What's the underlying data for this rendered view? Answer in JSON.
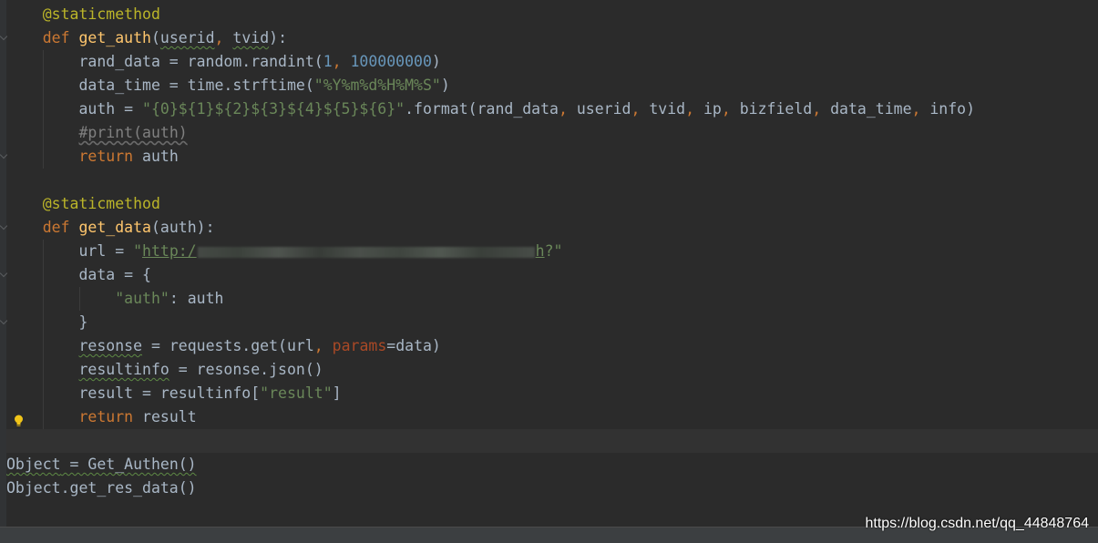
{
  "editor": {
    "lines": [
      [
        {
          "t": "    "
        },
        {
          "t": "@staticmethod",
          "c": "deco"
        }
      ],
      [
        {
          "t": "    "
        },
        {
          "t": "def ",
          "c": "kw"
        },
        {
          "t": "get_auth",
          "c": "fn"
        },
        {
          "t": "("
        },
        {
          "t": "userid",
          "w": 1
        },
        {
          "t": ", ",
          "c": "kw"
        },
        {
          "t": "tvid",
          "w": 1
        },
        {
          "t": "):"
        }
      ],
      [
        {
          "t": "        rand_data = random.randint("
        },
        {
          "t": "1",
          "c": "num"
        },
        {
          "t": ", ",
          "c": "kw"
        },
        {
          "t": "100000000",
          "c": "num"
        },
        {
          "t": ")"
        }
      ],
      [
        {
          "t": "        data_time = time.strftime("
        },
        {
          "t": "\"%Y%m%d%H%M%S\"",
          "c": "str"
        },
        {
          "t": ")"
        }
      ],
      [
        {
          "t": "        auth = "
        },
        {
          "t": "\"{0}${1}${2}${3}${4}${5}${6}\"",
          "c": "str"
        },
        {
          "t": ".format(rand_data"
        },
        {
          "t": ", ",
          "c": "kw"
        },
        {
          "t": "userid"
        },
        {
          "t": ", ",
          "c": "kw"
        },
        {
          "t": "tvid"
        },
        {
          "t": ", ",
          "c": "kw"
        },
        {
          "t": "ip"
        },
        {
          "t": ", ",
          "c": "kw"
        },
        {
          "t": "bizfield"
        },
        {
          "t": ", ",
          "c": "kw"
        },
        {
          "t": "data_time"
        },
        {
          "t": ", ",
          "c": "kw"
        },
        {
          "t": "info)"
        }
      ],
      [
        {
          "t": "        "
        },
        {
          "t": "#print(auth)",
          "c": "cmt"
        }
      ],
      [
        {
          "t": "        "
        },
        {
          "t": "return ",
          "c": "kw"
        },
        {
          "t": "auth"
        }
      ],
      [],
      [
        {
          "t": "    "
        },
        {
          "t": "@staticmethod",
          "c": "deco"
        }
      ],
      [
        {
          "t": "    "
        },
        {
          "t": "def ",
          "c": "kw"
        },
        {
          "t": "get_data",
          "c": "fn"
        },
        {
          "t": "(auth):"
        }
      ],
      [
        {
          "t": "        url = "
        },
        {
          "t": "\"",
          "c": "str"
        },
        {
          "t": "http:/",
          "c": "str",
          "l": 1
        },
        {
          "blur": 1
        },
        {
          "t": "h",
          "c": "str",
          "l": 1
        },
        {
          "t": "?\"",
          "c": "str"
        }
      ],
      [
        {
          "t": "        data = {"
        }
      ],
      [
        {
          "t": "            "
        },
        {
          "t": "\"auth\"",
          "c": "str"
        },
        {
          "t": ": auth"
        }
      ],
      [
        {
          "t": "        }"
        }
      ],
      [
        {
          "t": "        "
        },
        {
          "t": "resonse",
          "w": 1
        },
        {
          "t": " = requests.get(url"
        },
        {
          "t": ", ",
          "c": "kw"
        },
        {
          "t": "params",
          "c": "param"
        },
        {
          "t": "=data)"
        }
      ],
      [
        {
          "t": "        "
        },
        {
          "t": "resultinfo",
          "w": 1
        },
        {
          "t": " = resonse.json()"
        }
      ],
      [
        {
          "t": "        result = resultinfo["
        },
        {
          "t": "\"result\"",
          "c": "str"
        },
        {
          "t": "]"
        }
      ],
      [
        {
          "t": "        "
        },
        {
          "t": "return ",
          "c": "kw"
        },
        {
          "t": "result"
        }
      ],
      [],
      [
        {
          "t": "Object",
          "w": 1
        },
        {
          "t": " = Get_Authen()",
          "w": 1
        }
      ],
      [
        {
          "t": "Object.get_res_data()"
        }
      ]
    ],
    "current_line": 18
  },
  "icons": {
    "intention_bulb": "lightbulb-icon"
  },
  "colors": {
    "background": "#2b2b2b",
    "keyword": "#cc7832",
    "function": "#ffc66d",
    "decorator": "#bbb529",
    "number": "#6897bb",
    "string": "#6a8759",
    "comment": "#808080",
    "parameter": "#aa4926",
    "text": "#a9b7c6"
  },
  "watermark": {
    "text": "https://blog.csdn.net/qq_44848764"
  }
}
